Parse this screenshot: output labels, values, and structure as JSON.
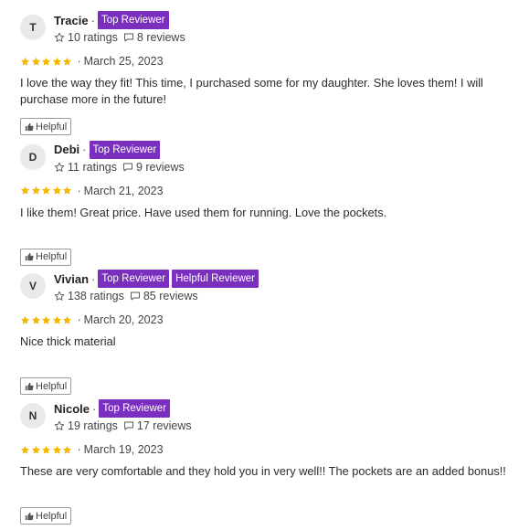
{
  "colors": {
    "badge": "#7b2fbf",
    "star": "#f5b800"
  },
  "icons": {
    "star_outline": "star-outline-icon",
    "comment": "comment-icon",
    "star_filled": "star-filled-icon",
    "thumbs_up": "thumbs-up-icon"
  },
  "reviews": [
    {
      "initial": "T",
      "name": "Tracie",
      "separator": "·",
      "badges": [
        "Top Reviewer"
      ],
      "ratings": "10 ratings",
      "reviews_count": "8 reviews",
      "stars": 5,
      "date_prefix": "·",
      "date": "March 25, 2023",
      "text": "I love the way they fit! This time, I purchased some for my daughter. She loves them! I will purchase more in the future!",
      "helpful_label": "Helpful"
    },
    {
      "initial": "D",
      "name": "Debi",
      "separator": "·",
      "badges": [
        "Top Reviewer"
      ],
      "ratings": "11 ratings",
      "reviews_count": "9 reviews",
      "stars": 5,
      "date_prefix": "·",
      "date": "March 21, 2023",
      "text": "I like them! Great price. Have used them for running. Love the pockets.",
      "helpful_label": "Helpful"
    },
    {
      "initial": "V",
      "name": "Vivian",
      "separator": "·",
      "badges": [
        "Top Reviewer",
        "Helpful Reviewer"
      ],
      "ratings": "138 ratings",
      "reviews_count": "85 reviews",
      "stars": 5,
      "date_prefix": "·",
      "date": "March 20, 2023",
      "text": "Nice thick material",
      "helpful_label": "Helpful"
    },
    {
      "initial": "N",
      "name": "Nicole",
      "separator": "·",
      "badges": [
        "Top Reviewer"
      ],
      "ratings": "19 ratings",
      "reviews_count": "17 reviews",
      "stars": 5,
      "date_prefix": "·",
      "date": "March 19, 2023",
      "text": "These are very comfortable and they hold you in very well!! The pockets are an added bonus!!",
      "helpful_label": "Helpful"
    }
  ]
}
